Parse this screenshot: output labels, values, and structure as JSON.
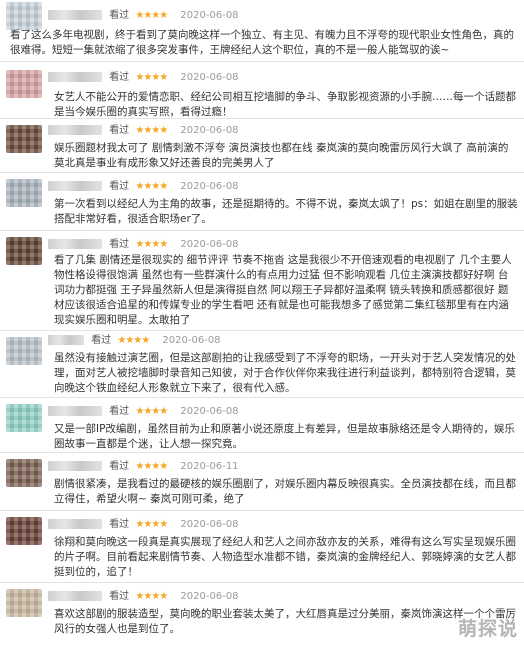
{
  "reviews": [
    {
      "action": "看过",
      "stars": "★★★★",
      "date": "2020-06-08",
      "color": "#c9d3db",
      "text": "看了这么多年电视剧，终于看到了莫向晚这样一个独立、有主见、有魄力且不浮夸的现代职业女性角色，真的很难得。短短一集就浓缩了很多突发事件，王牌经纪人这个职位，真的不是一般人能驾驭的诶~"
    },
    {
      "action": "看过",
      "stars": "★★★★",
      "date": "2020-06-08",
      "color": "#d8a0a0",
      "text": "女艺人不能公开的爱情恋职、经纪公司相互挖墙脚的争斗、争取影视资源的小手腕……每一个话题都是当今娱乐圈的真实写照，看得过瘾！"
    },
    {
      "action": "看过",
      "stars": "★★★★",
      "date": "2020-06-08",
      "color": "#6b4a3a",
      "text": "娱乐圈题材我太可了 剧情刺激不浮夸 演员演技也都在线 秦岚演的莫向晚雷厉风行大飒了 高前演的莫北真是事业有成形象又好还善良的完美男人了"
    },
    {
      "action": "看过",
      "stars": "★★★★",
      "date": "2020-06-08",
      "color": "#a9b4bd",
      "text": "第一次看到以经纪人为主角的故事，还是挺期待的。不得不说，秦岚太飒了！ps：如姐在剧里的服装搭配非常好看，很适合职场er了。"
    },
    {
      "action": "看过",
      "stars": "★★★★",
      "date": "2020-06-08",
      "color": "#5e4030",
      "text": "看了几集 剧情还是很现实的 细节评评 节奏不拖沓 这是我很少不开倍速观看的电视剧了 几个主要人物性格设得很饱满 虽然也有一些群演什么的有点用力过猛 但不影响观看 几位主演演技都好好啊 台词功力都挺强 王子异虽然新人但是演得挺自然 阿以翔王子异都好温柔啊 镜头转换和质感都很好 题材应该很适合追星的和传媒专业的学生看吧 还有就是也可能我想多了感觉第二集红毯那里有在内涵现实娱乐圈和明星。太敢拍了"
    },
    {
      "action": "看过",
      "stars": "★★★★",
      "date": "2020-06-08",
      "color": "#b8c2c9",
      "text": "虽然没有接触过演艺圈，但是这部剧拍的让我感受到了不浮夸的职场，一开头对于艺人突发情况的处理，面对艺人被挖墙脚时录音知己知彼，对于合作伙伴你来我往进行利益谈判，都特别符合逻辑，莫向晚这个铁血经纪人形象就立下来了，很有代入感。"
    },
    {
      "action": "看过",
      "stars": "★★★★",
      "date": "2020-06-08",
      "color": "#8fd0c6",
      "text": "又是一部IP改编剧，虽然目前为止和原著小说还原度上有差异，但是故事脉络还是令人期待的，娱乐圈故事一直都是个迷，让人想一探究竟。"
    },
    {
      "action": "看过",
      "stars": "★★★★",
      "date": "2020-06-11",
      "color": "#7a5e50",
      "text": "剧情很紧凑，是我看过的最硬核的娱乐圈剧了，对娱乐圈内幕反映很真实。全员演技都在线，而且都立得住，希望火啊~ 秦岚可刚可柔，绝了"
    },
    {
      "action": "看过",
      "stars": "★★★★",
      "date": "2020-06-08",
      "color": "#6a4038",
      "text": "徐翔和莫向晚这一段真是真实展现了经纪人和艺人之间亦敌亦友的关系，难得有这么写实呈现娱乐圈的片子啊。目前看起来剧情节奏、人物造型水准都不错，秦岚演的金牌经纪人、郭晓婷演的女艺人都挺到位的，追了！"
    },
    {
      "action": "看过",
      "stars": "★★★★",
      "date": "2020-06-08",
      "color": "#c8b8a0",
      "text": "喜欢这部剧的服装造型，莫向晚的职业套装太美了，大红唇真是过分美丽，秦岚饰演这样一个个雷厉风行的女强人也是到位了。"
    }
  ],
  "watermark": "萌探说",
  "icons": {
    "star": "star-icon"
  }
}
